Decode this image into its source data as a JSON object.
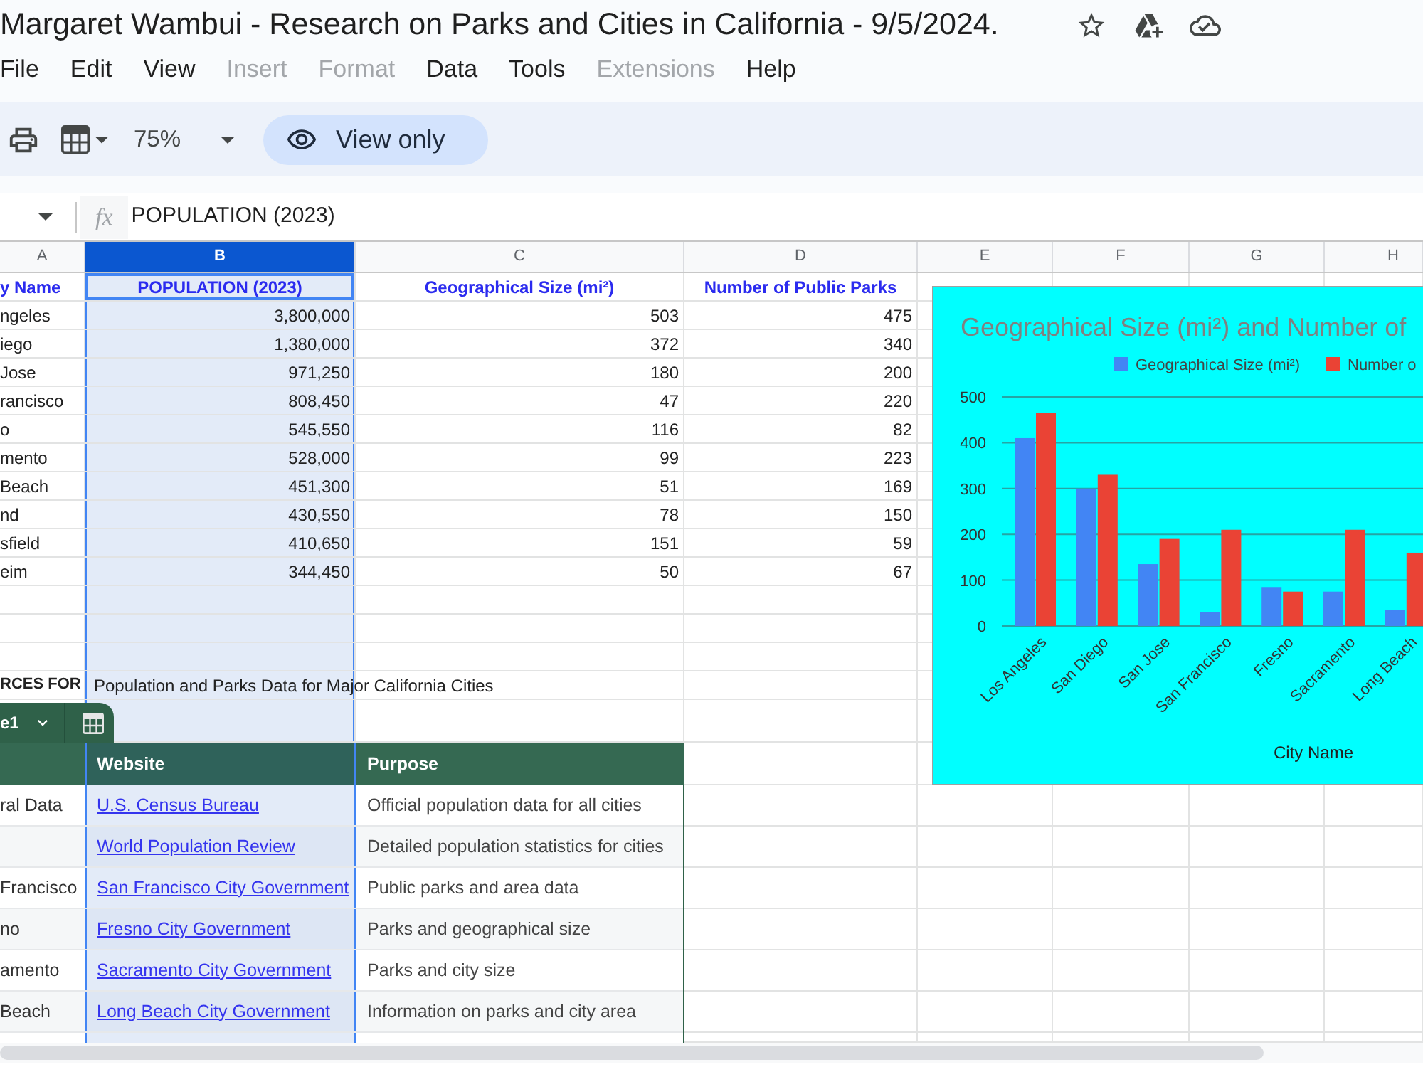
{
  "document": {
    "title": "Margaret Wambui - Research on Parks and Cities in California - 9/5/2024."
  },
  "menu": [
    {
      "label": "File",
      "disabled": false
    },
    {
      "label": "Edit",
      "disabled": false
    },
    {
      "label": "View",
      "disabled": false
    },
    {
      "label": "Insert",
      "disabled": true
    },
    {
      "label": "Format",
      "disabled": true
    },
    {
      "label": "Data",
      "disabled": false
    },
    {
      "label": "Tools",
      "disabled": false
    },
    {
      "label": "Extensions",
      "disabled": true
    },
    {
      "label": "Help",
      "disabled": false
    }
  ],
  "toolbar": {
    "zoom": "75%",
    "mode": "View only"
  },
  "formula_bar": {
    "fx": "fx",
    "content": "POPULATION (2023)"
  },
  "column_headers": [
    {
      "label": "A",
      "selected": false
    },
    {
      "label": "B",
      "selected": true
    },
    {
      "label": "C",
      "selected": false
    },
    {
      "label": "D",
      "selected": false
    },
    {
      "label": "E",
      "selected": false
    },
    {
      "label": "F",
      "selected": false
    },
    {
      "label": "G",
      "selected": false
    },
    {
      "label": "H",
      "selected": false
    }
  ],
  "sheet": {
    "header": [
      "y Name",
      "POPULATION (2023)",
      "Geographical Size (mi²)",
      "Number of Public Parks"
    ],
    "rows": [
      [
        "ngeles",
        "3,800,000",
        "503",
        "475"
      ],
      [
        "iego",
        "1,380,000",
        "372",
        "340"
      ],
      [
        "Jose",
        "971,250",
        "180",
        "200"
      ],
      [
        "rancisco",
        "808,450",
        "47",
        "220"
      ],
      [
        "o",
        "545,550",
        "116",
        "82"
      ],
      [
        "mento",
        "528,000",
        "99",
        "223"
      ],
      [
        "Beach",
        "451,300",
        "51",
        "169"
      ],
      [
        "nd",
        "430,550",
        "78",
        "150"
      ],
      [
        "sfield",
        "410,650",
        "151",
        "59"
      ],
      [
        "eim",
        "344,450",
        "50",
        "67"
      ]
    ]
  },
  "sources": {
    "label": "RCES FOR",
    "title": "Population and Parks Data for Major California Cities"
  },
  "table": {
    "name": "e1",
    "columns": [
      "Website",
      "Purpose"
    ],
    "rows": [
      {
        "column_1": "ral Data",
        "website": "U.S. Census Bureau",
        "purpose": "Official population data for all cities"
      },
      {
        "website": "World Population Review",
        "purpose": "Detailed population statistics for cities"
      },
      {
        "column_1": "Francisco",
        "website": "San Francisco City Government",
        "purpose": "Public parks and area data"
      },
      {
        "column_1": "no",
        "website": "Fresno City Government",
        "purpose": "Parks and geographical size"
      },
      {
        "column_1": "amento",
        "website": "Sacramento City Government",
        "purpose": "Parks and city size"
      },
      {
        "column_1": "Beach",
        "website": "Long Beach City Government",
        "purpose": "Information on parks and city area"
      }
    ]
  },
  "chart": {
    "chart_data": {
      "type": "bar",
      "title": "Geographical Size (mi²) and Number of",
      "xlabel": "City Name",
      "categories": [
        "Los Angeles",
        "San Diego",
        "San Jose",
        "San Francisco",
        "Fresno",
        "Sacramento",
        "Long Beach"
      ],
      "series": [
        {
          "name": "Geographical Size (mi²)",
          "color": "#4285f4",
          "values": [
            410,
            300,
            135,
            30,
            85,
            75,
            35
          ]
        },
        {
          "name": "Number o",
          "color": "#ea4335",
          "values": [
            465,
            330,
            190,
            210,
            75,
            210,
            160
          ]
        }
      ],
      "ylim": [
        0,
        500
      ],
      "yticks": [
        0,
        100,
        200,
        300,
        400,
        500
      ],
      "grid": true,
      "legend": "top"
    }
  }
}
